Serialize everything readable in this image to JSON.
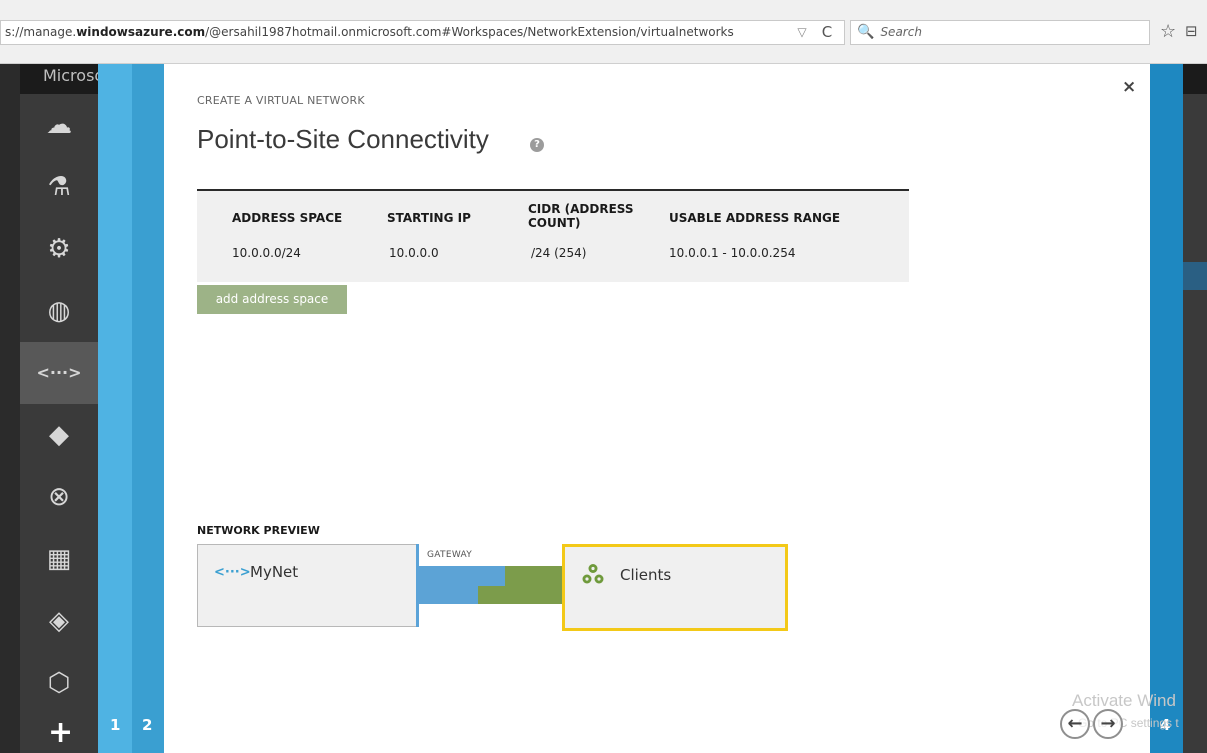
{
  "browser": {
    "url_prefix": "s://manage.",
    "url_domain": "windowsazure.com",
    "url_rest": "/@ersahil1987hotmail.onmicrosoft.com#Workspaces/NetworkExtension/virtualnetworks",
    "dropdown_icon": "▽",
    "reload_icon": "C",
    "search_placeholder": "Search",
    "search_icon": "🔍",
    "star_icon": "☆",
    "reader_icon": "⊟"
  },
  "portal": {
    "brand": "Microso",
    "add_icon": "+"
  },
  "wizard": {
    "caption": "CREATE A VIRTUAL NETWORK",
    "title": "Point-to-Site Connectivity",
    "help_icon": "?",
    "close_icon": "×",
    "steps": {
      "one": "1",
      "two": "2",
      "four": "4"
    }
  },
  "address_table": {
    "headers": {
      "address_space": "ADDRESS SPACE",
      "starting_ip": "STARTING IP",
      "cidr_line1": "CIDR (ADDRESS",
      "cidr_line2": "COUNT)",
      "usable_range": "USABLE ADDRESS RANGE"
    },
    "rows": [
      {
        "address_space": "10.0.0.0/24",
        "starting_ip": "10.0.0.0",
        "cidr": "/24 (254)",
        "usable_range": "10.0.0.1 - 10.0.0.254"
      }
    ],
    "add_button": "add address space"
  },
  "network_preview": {
    "label": "NETWORK PREVIEW",
    "network_name": "MyNet",
    "network_icon": "<···>",
    "gateway_label": "GATEWAY",
    "clients_label": "Clients"
  },
  "nav": {
    "prev_icon": "←",
    "next_icon": "→"
  },
  "watermark": {
    "line1": "Activate Wind",
    "line2": "Go to PC settings t"
  },
  "colors": {
    "step_blue_light": "#4fb3e3",
    "step_blue": "#1e88c1",
    "add_button": "#9db387",
    "gateway_blue": "#5ca3d6",
    "gateway_green": "#7c9c4b",
    "clients_border": "#f3c918"
  }
}
